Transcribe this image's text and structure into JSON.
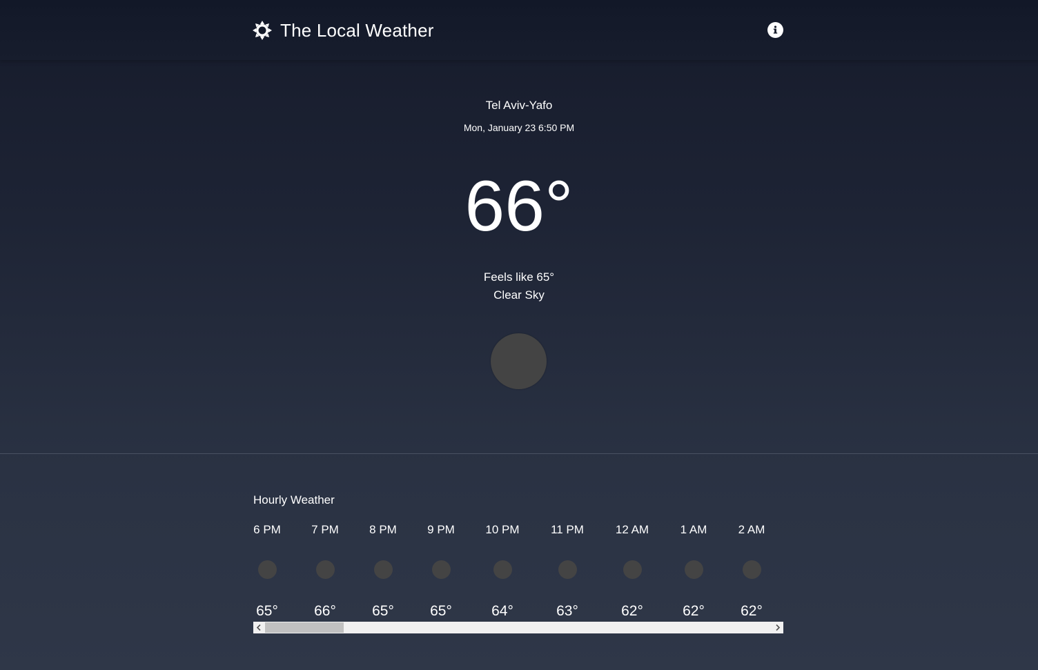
{
  "header": {
    "title": "The Local Weather",
    "logo_icon": "sun-gear-icon",
    "info_icon": "info-icon"
  },
  "current": {
    "location": "Tel Aviv-Yafo",
    "datetime": "Mon, January 23 6:50 PM",
    "temperature": "66°",
    "feels_like": "Feels like 65°",
    "condition": "Clear Sky",
    "icon": "weather-icon-placeholder"
  },
  "hourly": {
    "title": "Hourly Weather",
    "items": [
      {
        "time": "6 PM",
        "temp": "65°"
      },
      {
        "time": "7 PM",
        "temp": "66°"
      },
      {
        "time": "8 PM",
        "temp": "65°"
      },
      {
        "time": "9 PM",
        "temp": "65°"
      },
      {
        "time": "10 PM",
        "temp": "64°"
      },
      {
        "time": "11 PM",
        "temp": "63°"
      },
      {
        "time": "12 AM",
        "temp": "62°"
      },
      {
        "time": "1 AM",
        "temp": "62°"
      },
      {
        "time": "2 AM",
        "temp": "62°"
      }
    ]
  },
  "colors": {
    "background_top": "#161b2b",
    "background_bottom": "#2f3748",
    "icon_placeholder": "#444444",
    "text": "#ffffff"
  }
}
